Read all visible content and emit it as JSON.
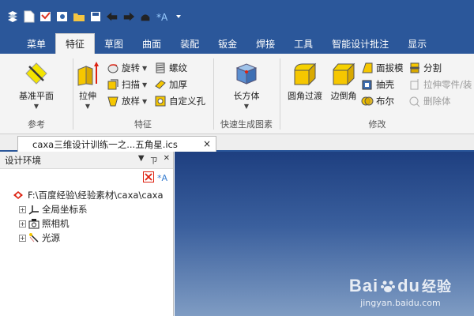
{
  "quick_access": {
    "icons": [
      "app-logo-icon",
      "new-file-icon",
      "email-icon",
      "settings-doc-icon",
      "open-folder-icon",
      "save-icon",
      "undo-icon",
      "redo-icon",
      "render-icon",
      "sparkle-icon",
      "customize-dropdown-icon"
    ]
  },
  "tabs": [
    {
      "label": "菜单"
    },
    {
      "label": "特征",
      "active": true
    },
    {
      "label": "草图"
    },
    {
      "label": "曲面"
    },
    {
      "label": "装配"
    },
    {
      "label": "钣金"
    },
    {
      "label": "焊接"
    },
    {
      "label": "工具"
    },
    {
      "label": "智能设计批注"
    },
    {
      "label": "显示"
    }
  ],
  "ribbon": {
    "reference": {
      "group_label": "参考",
      "datum_plane": "基准平面"
    },
    "feature": {
      "group_label": "特征",
      "extrude": "拉伸",
      "revolve": "旋转",
      "sweep": "扫描",
      "loft": "放样",
      "thread": "螺纹",
      "thicken": "加厚",
      "custom_hole": "自定义孔"
    },
    "quick": {
      "group_label": "快速生成图素",
      "box": "长方体"
    },
    "modify": {
      "group_label": "修改",
      "fillet": "圆角过渡",
      "chamfer": "边倒角",
      "draft": "面拔模",
      "shell": "抽壳",
      "boolean": "布尔",
      "split": "分割",
      "extrude_part": "拉伸零件/装",
      "delete_body": "删除体"
    }
  },
  "document": {
    "tab_title": "caxa三维设计训练一之...五角星.ics",
    "close": "×"
  },
  "panel": {
    "title": "设计环境",
    "pin": "▼",
    "dock": "ㄗ",
    "close": "✕",
    "tree": {
      "root": "F:\\百度经验\\经验素材\\caxa\\caxa",
      "children": [
        "全局坐标系",
        "照相机",
        "光源"
      ]
    }
  },
  "watermark": {
    "brand": "Bai",
    "brand2": "du",
    "brand3": "经验",
    "url": "jingyan.baidu.com"
  }
}
